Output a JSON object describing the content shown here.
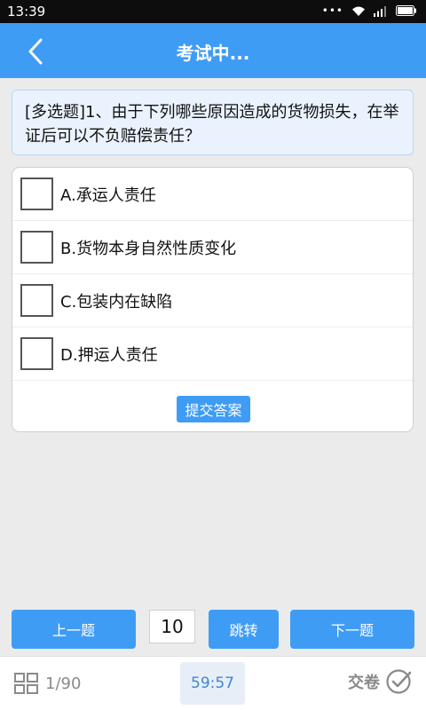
{
  "status_bar": {
    "time": "13:39",
    "icons": [
      "dots-icon",
      "wifi-icon",
      "signal-icon",
      "battery-icon"
    ]
  },
  "header": {
    "title": "考试中...",
    "back_icon": "chevron-left-icon"
  },
  "question": {
    "text": "[多选题]1、由于下列哪些原因造成的货物损失，在举证后可以不负赔偿责任？"
  },
  "options": [
    {
      "label": "A.承运人责任",
      "checked": false
    },
    {
      "label": "B.货物本身自然性质变化",
      "checked": false
    },
    {
      "label": "C.包装内在缺陷",
      "checked": false
    },
    {
      "label": "D.押运人责任",
      "checked": false
    }
  ],
  "submit_label": "提交答案",
  "navigation": {
    "prev_label": "上一题",
    "page_value": "10",
    "jump_label": "跳转",
    "next_label": "下一题"
  },
  "bottom": {
    "progress": "1/90",
    "timer": "59:57",
    "hand_in_label": "交卷"
  },
  "colors": {
    "primary": "#3f9cf5",
    "question_bg": "#eaf3fd",
    "timer_text": "#3f86d6",
    "muted": "#8a8a8a"
  }
}
